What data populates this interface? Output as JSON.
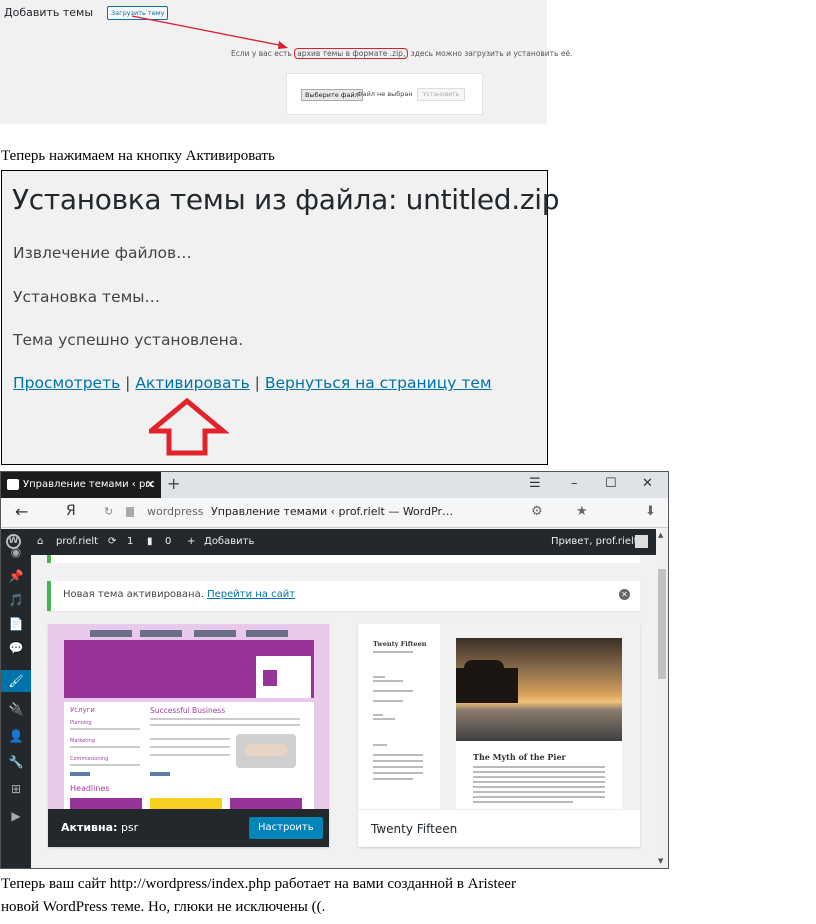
{
  "upload_screen": {
    "title": "Добавить темы",
    "upload_button": "Загрузить тему",
    "hint_before": "Если у вас есть ",
    "hint_highlight": "архив темы в формате .zip,",
    "hint_after": " здесь можно загрузить и установить её.",
    "choose_file_button": "Выберите файл",
    "no_file_text": "Файл не выбран",
    "install_button": "Установить",
    "annotation_color": "#d8202f"
  },
  "caption_1": "Теперь нажимаем на кнопку Активировать",
  "install_screen": {
    "title": "Установка темы из файла: untitled.zip",
    "steps": [
      "Извлечение файлов…",
      "Установка темы…",
      "Тема успешно установлена."
    ],
    "links": {
      "preview": "Просмотреть",
      "activate": "Активировать",
      "back": "Вернуться на страницу тем",
      "separator": " | "
    },
    "arrow_color": "#e3232c"
  },
  "browser": {
    "tab_title": "Управление темами ‹ prc",
    "tab_close": "✕",
    "new_tab": "+",
    "window_controls": [
      "☰",
      "–",
      "☐",
      "✕"
    ],
    "nav_back": "←",
    "engine_logo": "Я",
    "reload": "↻",
    "url_host": "wordpress",
    "url_page_title": "Управление темами ‹ prof.rielt — WordPr…",
    "toolbar_icons": [
      "⚙",
      "★",
      "⬇"
    ],
    "admin_bar": {
      "wp_logo": "W",
      "site_name": "prof.rielt",
      "updates_count": "1",
      "comments_count": "0",
      "add_new": "Добавить",
      "greeting": "Привет, prof.rielt"
    },
    "side_menu_icons": [
      "📌",
      "🎵",
      "📄",
      "💬",
      "🖌",
      "🔌",
      "👤",
      "🔧",
      "⊞",
      "▶"
    ],
    "notice": {
      "message": "Новая тема активирована.",
      "link": "Перейти на сайт",
      "dismiss": "✕"
    },
    "active_theme": {
      "label": "Активна:",
      "name": "psr",
      "customize_button": "Настроить",
      "preview_headings": [
        "Услуги",
        "Successful Business",
        "Planning",
        "Marketing",
        "Commissioning",
        "Headlines"
      ]
    },
    "other_theme": {
      "name": "Twenty Fifteen",
      "preview_site_name": "Twenty Fifteen",
      "preview_post_title": "The Myth of the Pier"
    },
    "wp_accent": "#0073aa",
    "success_green": "#46b450"
  },
  "caption_2": "Теперь ваш сайт http://wordpress/index.php работает на вами созданной в Aristeer",
  "caption_3": "новой WordPress теме. Но, глюки не исключены ((."
}
